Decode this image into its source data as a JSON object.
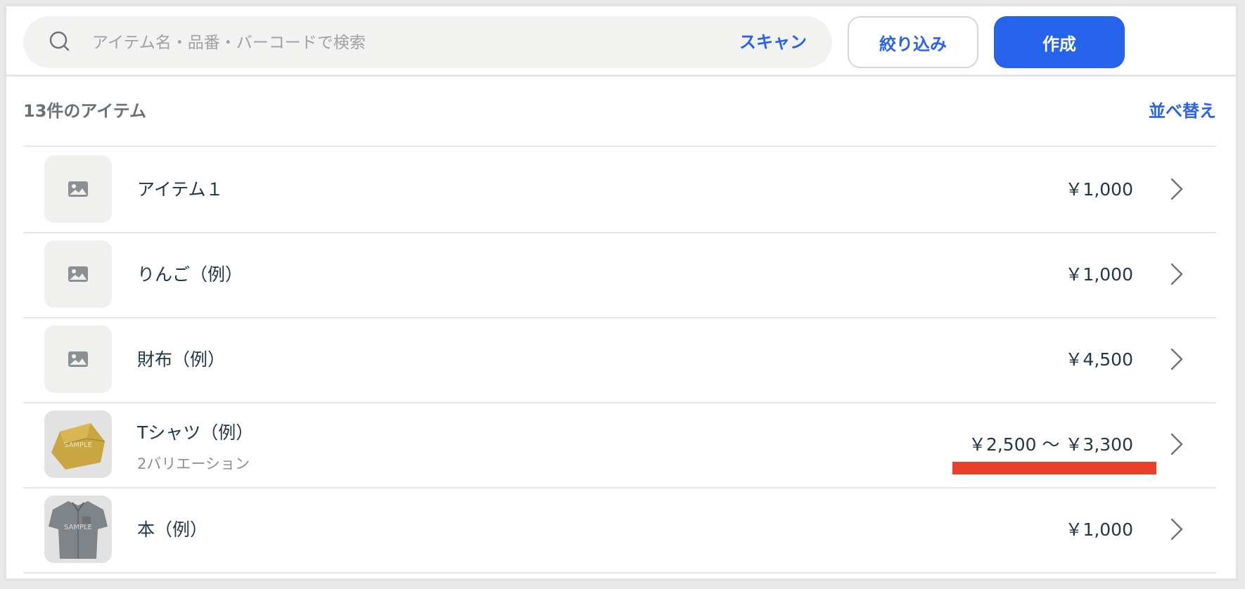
{
  "search": {
    "placeholder": "アイテム名・品番・バーコードで検索",
    "scan_label": "スキャン"
  },
  "buttons": {
    "filter_label": "絞り込み",
    "create_label": "作成"
  },
  "list": {
    "count_label": "13件のアイテム",
    "sort_label": "並べ替え",
    "items": [
      {
        "name": "アイテム１",
        "subtitle": "",
        "price": "￥1,000",
        "thumb": "image-placeholder-icon"
      },
      {
        "name": "りんご（例）",
        "subtitle": "",
        "price": "￥1,000",
        "thumb": "image-placeholder-icon"
      },
      {
        "name": "財布（例）",
        "subtitle": "",
        "price": "￥4,500",
        "thumb": "image-placeholder-icon"
      },
      {
        "name": "Tシャツ（例）",
        "subtitle": "2バリエーション",
        "price": "￥2,500 〜 ￥3,300",
        "thumb": "yellow-wallet-photo",
        "thumb_text": "SAMPLE"
      },
      {
        "name": "本（例）",
        "subtitle": "",
        "price": "￥1,000",
        "thumb": "grey-shirt-photo",
        "thumb_text": "SAMPLE"
      }
    ]
  },
  "colors": {
    "accent": "#2563eb",
    "highlight": "#e8402a",
    "text": "#243746",
    "muted": "#8a9196"
  }
}
